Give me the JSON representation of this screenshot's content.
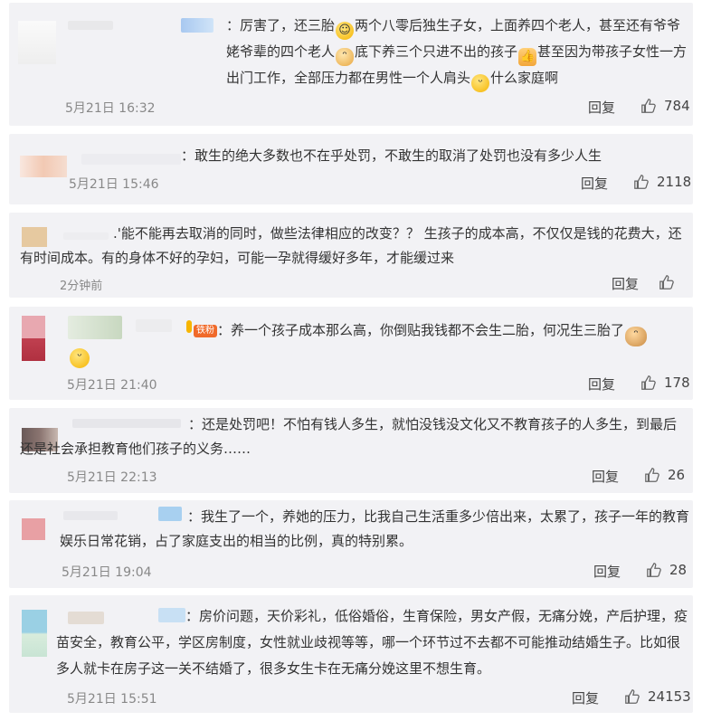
{
  "comments": [
    {
      "segments": [
        "：厉害了，还三胎",
        "两个八零后独生子女，上面养四个老人，甚至还有爷爷姥爷辈的四个老人",
        "底下养三个只进不出的孩子",
        "甚至因为带孩子女性一方出门工作，全部压力都在男性一个人肩头",
        "什么家庭啊"
      ],
      "emojis": [
        "smile-emoji",
        "cat-emoji",
        "thumbs-up-emoji",
        "laugh-emoji"
      ],
      "time": "5月21日 16:32",
      "reply": "回复",
      "likes": "784"
    },
    {
      "segments": [
        "：敢生的绝大多数也不在乎处罚，不敢生的取消了处罚也没有多少人生"
      ],
      "time": "5月21日 15:46",
      "reply": "回复",
      "likes": "2118"
    },
    {
      "segments": [
        ".'能不能再去取消的同时，做些法律相应的改变？？ 生孩子的成本高，不仅仅是钱的花费大，还有时间成本。有的身体不好的孕妇，可能一孕就得缓好多年，才能缓过来"
      ],
      "time": "2分钟前",
      "reply": "回复",
      "likes": ""
    },
    {
      "badge": "铁粉",
      "segments": [
        "：养一个孩子成本那么高，你倒贴我钱都不会生二胎，何况生三胎了"
      ],
      "emojis": [
        "cat-emoji",
        "laugh-emoji"
      ],
      "time": "5月21日 21:40",
      "reply": "回复",
      "likes": "178"
    },
    {
      "segments": [
        "：还是处罚吧！不怕有钱人多生，就怕没钱没文化又不教育孩子的人多生，到最后还是社会承担教育他们孩子的义务……"
      ],
      "time": "5月21日 22:13",
      "reply": "回复",
      "likes": "26"
    },
    {
      "segments": [
        "：我生了一个，养她的压力，比我自己生活重多少倍出来，太累了，孩子一年的教育娱乐日常花销，占了家庭支出的相当的比例，真的特别累。"
      ],
      "time": "5月21日 19:04",
      "reply": "回复",
      "likes": "28"
    },
    {
      "segments": [
        "：房价问题，天价彩礼，低俗婚俗，生育保险，男女产假，无痛分娩，产后护理，疫苗安全，教育公平，学区房制度，女性就业歧视等等，哪一个环节过不去都不可能推动结婚生子。比如很多人就卡在房子这一关不结婚了，很多女生卡在无痛分娩这里不想生育。"
      ],
      "time": "5月21日 15:51",
      "reply": "回复",
      "likes": "24153"
    }
  ],
  "colors": {
    "card_bg": "#f2f2f5",
    "text": "#333333",
    "meta": "#888888"
  }
}
